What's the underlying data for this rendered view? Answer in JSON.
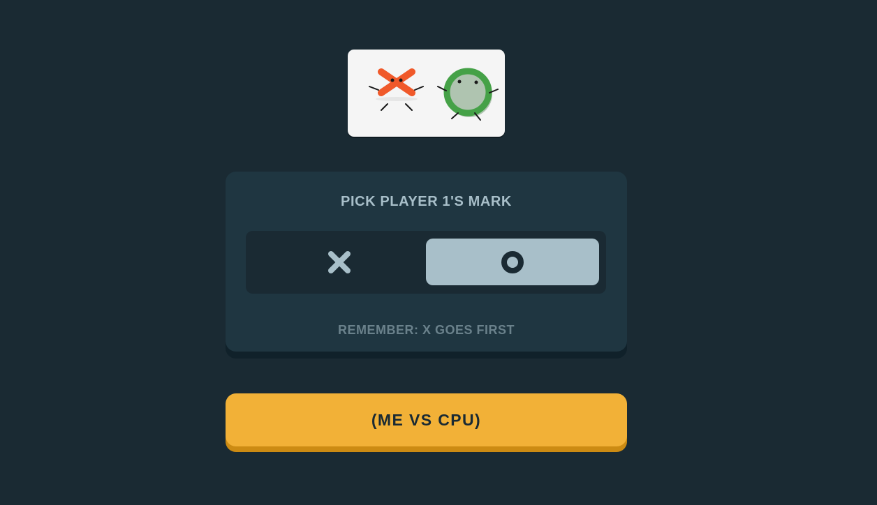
{
  "logo": {
    "icon": "x-and-o-characters-logo"
  },
  "mark_picker": {
    "title": "PICK PLAYER 1'S MARK",
    "options": [
      {
        "mark": "X",
        "selected": false
      },
      {
        "mark": "O",
        "selected": true
      }
    ],
    "note": "REMEMBER: X GOES FIRST"
  },
  "actions": {
    "cpu_button_label": "(ME VS CPU)"
  },
  "colors": {
    "background": "#1a2a33",
    "panel": "#1f3641",
    "silver": "#a8bfc9",
    "yellow": "#f2b137",
    "logo_x": "#f0592a",
    "logo_o": "#45a147"
  }
}
